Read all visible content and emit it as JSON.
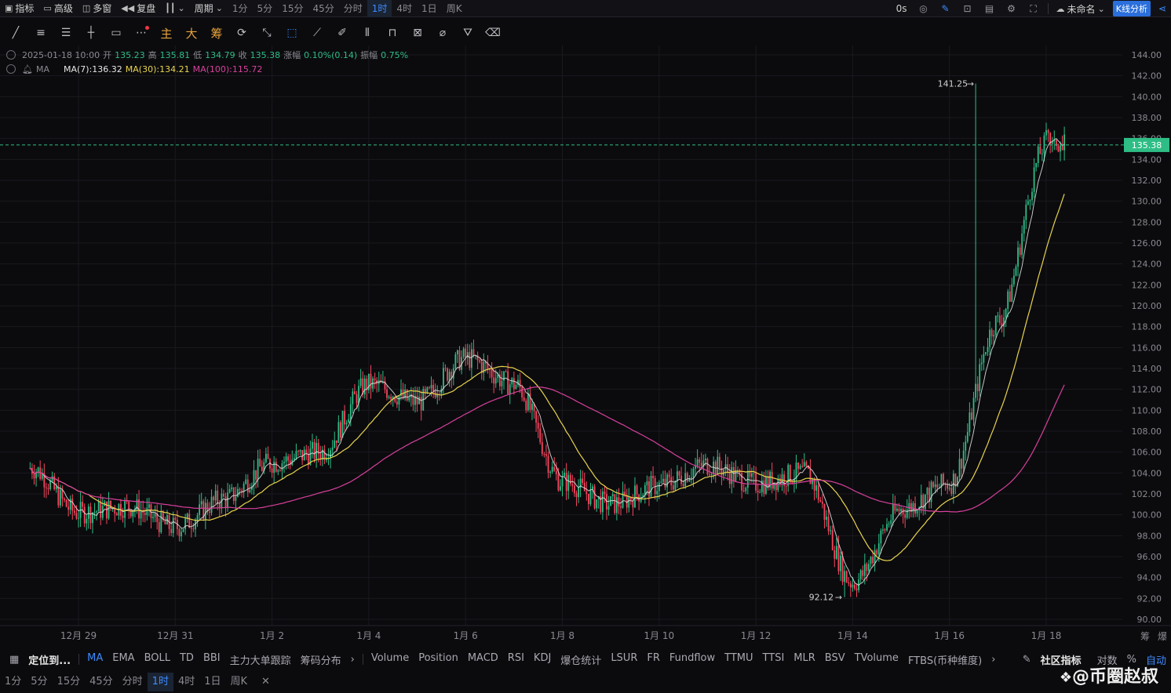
{
  "top_toolbar": {
    "indicators": "指标",
    "advanced": "高级",
    "multi_window": "多窗",
    "replay": "复盘",
    "period": "周期",
    "timeframes": [
      "1分",
      "5分",
      "15分",
      "45分",
      "分时",
      "1时",
      "4时",
      "1日",
      "周K"
    ],
    "active_timeframe_index": 5,
    "latency": "0s",
    "layout_name": "未命名",
    "kline_analysis": "K线分析"
  },
  "draw_toolbar": {
    "main": "主",
    "big": "大",
    "chips": "筹"
  },
  "legend": {
    "datetime": "2025-01-18 10:00",
    "open_label": "开",
    "open": "135.23",
    "high_label": "高",
    "high": "135.81",
    "low_label": "低",
    "low": "134.79",
    "close_label": "收",
    "close": "135.38",
    "change_label": "涨幅",
    "change": "0.10%(0.14)",
    "amp_label": "振幅",
    "amp": "0.75%",
    "ma_title": "MA",
    "ma7": "MA(7):136.32",
    "ma30": "MA(30):134.21",
    "ma100": "MA(100):115.72"
  },
  "colors": {
    "up": "#2ebd85",
    "down": "#f6465d",
    "ma7": "#e6e6e6",
    "ma30": "#e8d44d",
    "ma100": "#d8409b",
    "accent": "#3d8bff",
    "price_line": "#2ebd85"
  },
  "chart_data": {
    "type": "candlestick",
    "timeframe": "1时",
    "ylim": [
      90,
      144
    ],
    "y_ticks": [
      "144.00",
      "142.00",
      "140.00",
      "138.00",
      "136.00",
      "134.00",
      "132.00",
      "130.00",
      "128.00",
      "126.00",
      "124.00",
      "122.00",
      "120.00",
      "118.00",
      "116.00",
      "114.00",
      "112.00",
      "110.00",
      "108.00",
      "106.00",
      "104.00",
      "102.00",
      "100.00",
      "98.00",
      "96.00",
      "94.00",
      "92.00",
      "90.00"
    ],
    "x_labels": [
      "12月 29",
      "12月 31",
      "1月 2",
      "1月 4",
      "1月 6",
      "1月 8",
      "1月 10",
      "1月 12",
      "1月 14",
      "1月 16",
      "1月 18"
    ],
    "last_price": "135.38",
    "max_label": "141.25",
    "min_label": "92.12",
    "price_path_by_day": [
      [
        "12月 28",
        104.5
      ],
      [
        "12月 29",
        100.2
      ],
      [
        "12月 30",
        100.8
      ],
      [
        "12月 31",
        98.8
      ],
      [
        "1月 1",
        101.5
      ],
      [
        "1月 2",
        105.0
      ],
      [
        "1月 3",
        106.0
      ],
      [
        "1月 4",
        112.5
      ],
      [
        "1月 5",
        110.8
      ],
      [
        "1月 6",
        115.0
      ],
      [
        "1月 7",
        112.5
      ],
      [
        "1月 8",
        103.2
      ],
      [
        "1月 9",
        101.0
      ],
      [
        "1月 10",
        102.8
      ],
      [
        "1月 11",
        104.8
      ],
      [
        "1月 12",
        103.0
      ],
      [
        "1月 13",
        104.0
      ],
      [
        "1月 14",
        93.5
      ],
      [
        "1月 15",
        100.5
      ],
      [
        "1月 16",
        103.0
      ],
      [
        "1月 17",
        118.5
      ],
      [
        "1月 18",
        135.4
      ]
    ],
    "ma_end_values": {
      "MA(7)": 136.32,
      "MA(30)": 134.21,
      "MA(100)": 115.72
    }
  },
  "right_corner_labels": [
    "筹",
    "爆"
  ],
  "bottom_indicators": {
    "locate": "定位到...",
    "main": [
      "MA",
      "EMA",
      "BOLL",
      "TD",
      "BBI",
      "主力大单跟踪",
      "筹码分布"
    ],
    "active_main": "MA",
    "sub": [
      "Volume",
      "Position",
      "MACD",
      "RSI",
      "KDJ",
      "爆仓统计",
      "LSUR",
      "FR",
      "Fundflow",
      "TTMU",
      "TTSI",
      "MLR",
      "BSV",
      "TVolume",
      "FTBS(币种维度)"
    ],
    "community": "社区指标",
    "log": "对数",
    "pct": "%",
    "auto": "自动"
  },
  "bottom_timeframes": [
    "1分",
    "5分",
    "15分",
    "45分",
    "分时",
    "1时",
    "4时",
    "1日",
    "周K"
  ],
  "bottom_active_index": 5,
  "watermark": "@币圈赵叔"
}
